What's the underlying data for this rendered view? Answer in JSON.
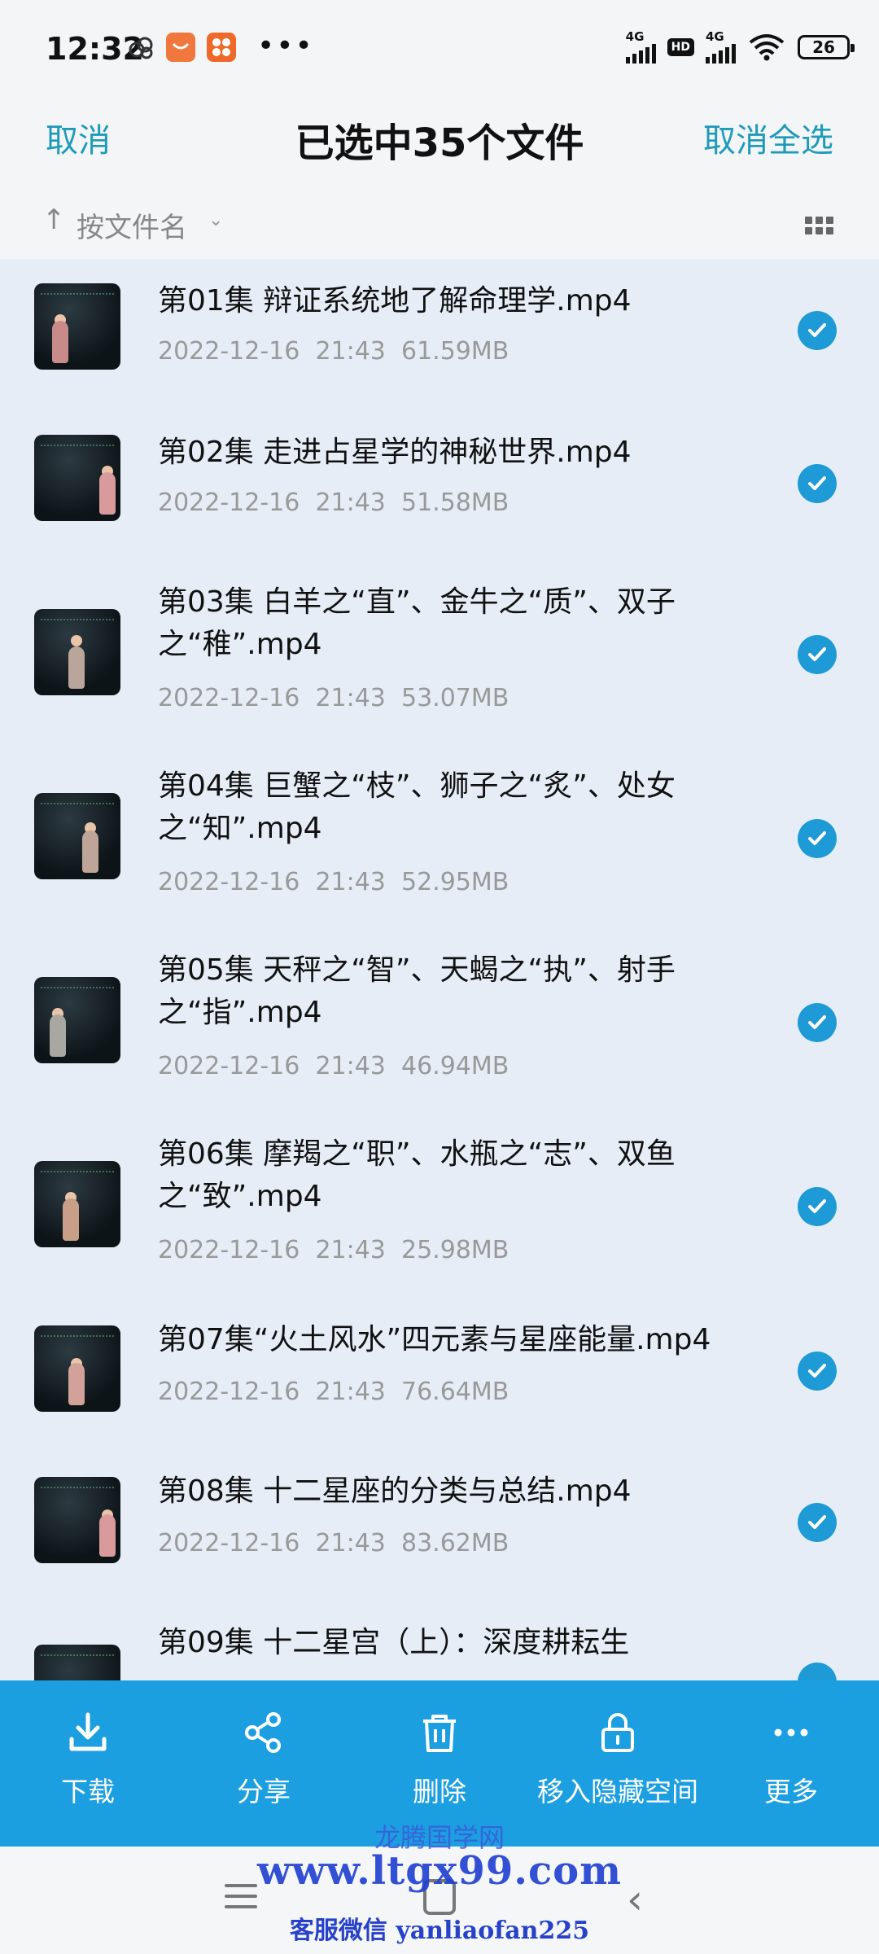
{
  "status_bar": {
    "time": "12:32",
    "more_indicator": "•••",
    "network1": "4G",
    "network2": "4G",
    "hd": "HD",
    "battery": "26"
  },
  "header": {
    "cancel": "取消",
    "title": "已选中35个文件",
    "deselect_all": "取消全选"
  },
  "sort": {
    "arrow": "↑",
    "label": "按文件名",
    "chevron": "⌄"
  },
  "files": [
    {
      "title": "第01集 辩证系统地了解命理学.mp4",
      "date": "2022-12-16",
      "time": "21:43",
      "size": "61.59MB",
      "selected": true
    },
    {
      "title": "第02集 走进占星学的神秘世界.mp4",
      "date": "2022-12-16",
      "time": "21:43",
      "size": "51.58MB",
      "selected": true
    },
    {
      "title": "第03集 白羊之“直”、金牛之“质”、双子之“稚”.mp4",
      "date": "2022-12-16",
      "time": "21:43",
      "size": "53.07MB",
      "selected": true
    },
    {
      "title": "第04集 巨蟹之“枝”、狮子之“炙”、处女之“知”.mp4",
      "date": "2022-12-16",
      "time": "21:43",
      "size": "52.95MB",
      "selected": true
    },
    {
      "title": "第05集 天秤之“智”、天蝎之“执”、射手之“指”.mp4",
      "date": "2022-12-16",
      "time": "21:43",
      "size": "46.94MB",
      "selected": true
    },
    {
      "title": "第06集 摩羯之“职”、水瓶之“志”、双鱼之“致”.mp4",
      "date": "2022-12-16",
      "time": "21:43",
      "size": "25.98MB",
      "selected": true
    },
    {
      "title": "第07集“火土风水”四元素与星座能量.mp4",
      "date": "2022-12-16",
      "time": "21:43",
      "size": "76.64MB",
      "selected": true
    },
    {
      "title": "第08集 十二星座的分类与总结.mp4",
      "date": "2022-12-16",
      "time": "21:43",
      "size": "83.62MB",
      "selected": true
    },
    {
      "title": "第09集 十二星宫（上）：深度耕耘生",
      "date": "",
      "time": "",
      "size": "",
      "selected": true
    }
  ],
  "actions": [
    {
      "label": "下载",
      "icon": "download-icon"
    },
    {
      "label": "分享",
      "icon": "share-icon"
    },
    {
      "label": "删除",
      "icon": "delete-icon"
    },
    {
      "label": "移入隐藏空间",
      "icon": "lock-icon"
    },
    {
      "label": "更多",
      "icon": "more-icon"
    }
  ],
  "watermark": {
    "line1": "龙腾国学网",
    "line2": "www.ltgx99.com",
    "line3": "客服微信 yanliaofan225"
  },
  "colors": {
    "accent": "#1e9bb8",
    "action_bar": "#1c9fe0",
    "check": "#1e9ad6",
    "list_bg": "#e6edf7"
  }
}
